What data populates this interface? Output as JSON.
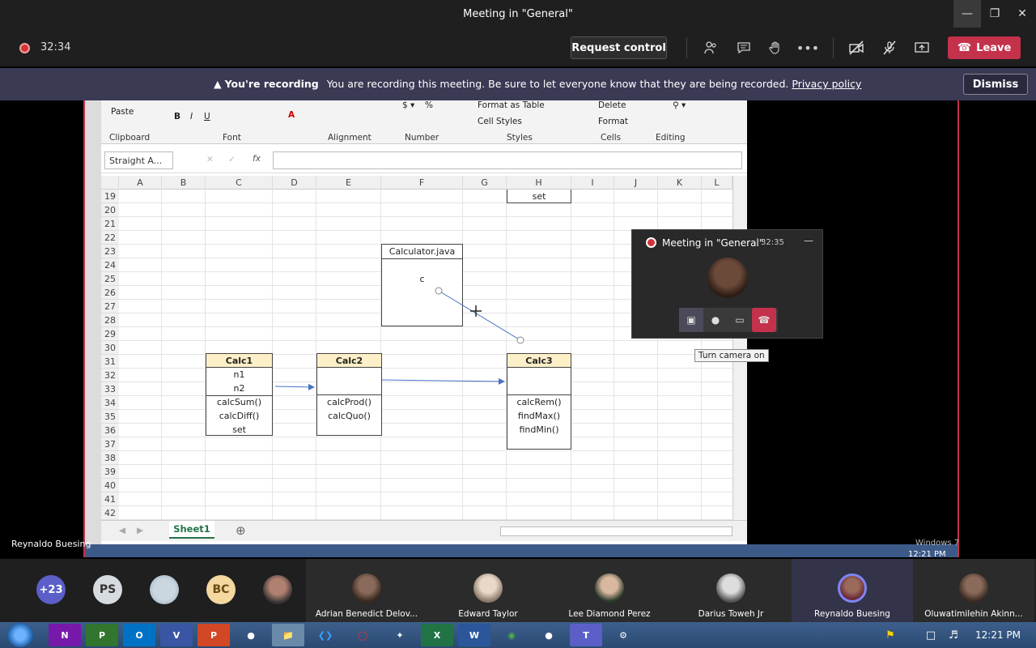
{
  "window": {
    "title": "Meeting in \"General\""
  },
  "toolbar": {
    "timer": "32:34",
    "request_control": "Request control",
    "leave": "Leave"
  },
  "banner": {
    "bold": "You're recording",
    "message": "You are recording this meeting. Be sure to let everyone know that they are being recorded.",
    "link": "Privacy policy",
    "dismiss": "Dismiss"
  },
  "excel": {
    "ribbon": {
      "groups": [
        "Clipboard",
        "Font",
        "Alignment",
        "Number",
        "Styles",
        "Cells",
        "Editing"
      ],
      "paste": "Paste",
      "format_as_table": "Format as Table",
      "cell_styles": "Cell Styles",
      "delete": "Delete",
      "format": "Format"
    },
    "name_box": "Straight A...",
    "fx": "fx",
    "columns": [
      "A",
      "B",
      "C",
      "D",
      "E",
      "F",
      "G",
      "H",
      "I",
      "J",
      "K",
      "L"
    ],
    "rows": [
      "19",
      "20",
      "21",
      "22",
      "23",
      "24",
      "25",
      "26",
      "27",
      "28",
      "29",
      "30",
      "31",
      "32",
      "33",
      "34",
      "35",
      "36",
      "37",
      "38",
      "39",
      "40",
      "41",
      "42"
    ],
    "cells": {
      "h19": "set",
      "calculator_title": "Calculator.java",
      "calculator_c": "c",
      "calc1": {
        "title": "Calc1",
        "lines": [
          "n1",
          "n2",
          "calcSum()",
          "calcDiff()",
          "set"
        ]
      },
      "calc2": {
        "title": "Calc2",
        "lines": [
          "calcProd()",
          "calcQuo()"
        ]
      },
      "calc3": {
        "title": "Calc3",
        "lines": [
          "calcRem()",
          "findMax()",
          "findMin()"
        ]
      }
    },
    "sheet_tab": "Sheet1"
  },
  "shared_screen": {
    "presenter_label": "Reynaldo Buesing",
    "windows_label": "Windows 7",
    "remote_time": "12:21 PM"
  },
  "mini_window": {
    "title": "Meeting in \"General\"",
    "time": "32:35",
    "tooltip": "Turn camera on"
  },
  "participants": {
    "overflow": "+23",
    "initials": [
      "PS",
      "BC"
    ],
    "tiles": [
      "Adrian Benedict Delov...",
      "Edward Taylor",
      "Lee Diamond Perez",
      "Darius Toweh Jr",
      "Reynaldo Buesing",
      "Oluwatimilehin Akinn..."
    ]
  },
  "taskbar": {
    "clock": "12:21 PM",
    "apps": [
      "N",
      "P",
      "O",
      "V",
      "P",
      "",
      "",
      "",
      "",
      "",
      "X",
      "W",
      "",
      "",
      "T",
      ""
    ]
  },
  "colors": {
    "leave": "#c4314b",
    "banner": "#3b3a55",
    "excel_green": "#217346",
    "header_fill": "#fdf0c8"
  }
}
